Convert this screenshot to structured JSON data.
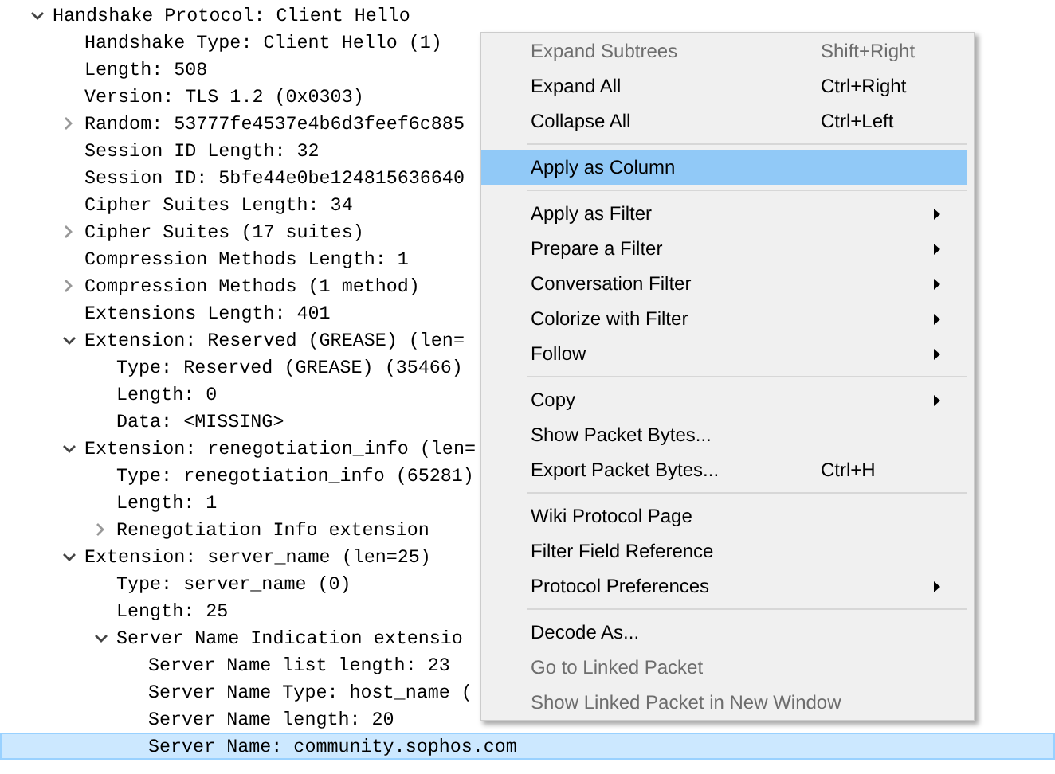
{
  "tree": [
    {
      "label": "Handshake Protocol: Client Hello",
      "expanded": true,
      "selected": false,
      "children": [
        {
          "label": "Handshake Type: Client Hello (1)",
          "selected": false
        },
        {
          "label": "Length: 508",
          "selected": false
        },
        {
          "label": "Version: TLS 1.2 (0x0303)",
          "selected": false
        },
        {
          "label": "Random: 53777fe4537e4b6d3feef6c885",
          "expanded": false,
          "selected": false
        },
        {
          "label": "Session ID Length: 32",
          "selected": false
        },
        {
          "label": "Session ID: 5bfe44e0be124815636640",
          "selected": false
        },
        {
          "label": "Cipher Suites Length: 34",
          "selected": false
        },
        {
          "label": "Cipher Suites (17 suites)",
          "expanded": false,
          "selected": false
        },
        {
          "label": "Compression Methods Length: 1",
          "selected": false
        },
        {
          "label": "Compression Methods (1 method)",
          "expanded": false,
          "selected": false
        },
        {
          "label": "Extensions Length: 401",
          "selected": false
        },
        {
          "label": "Extension: Reserved (GREASE) (len=",
          "expanded": true,
          "selected": false,
          "children": [
            {
              "label": "Type: Reserved (GREASE) (35466)",
              "selected": false
            },
            {
              "label": "Length: 0",
              "selected": false
            },
            {
              "label": "Data: <MISSING>",
              "selected": false
            }
          ]
        },
        {
          "label": "Extension: renegotiation_info (len=",
          "expanded": true,
          "selected": false,
          "children": [
            {
              "label": "Type: renegotiation_info (65281)",
              "selected": false
            },
            {
              "label": "Length: 1",
              "selected": false
            },
            {
              "label": "Renegotiation Info extension",
              "expanded": false,
              "selected": false
            }
          ]
        },
        {
          "label": "Extension: server_name (len=25)",
          "expanded": true,
          "selected": false,
          "children": [
            {
              "label": "Type: server_name (0)",
              "selected": false
            },
            {
              "label": "Length: 25",
              "selected": false
            },
            {
              "label": "Server Name Indication extensio",
              "expanded": true,
              "selected": false,
              "children": [
                {
                  "label": "Server Name list length: 23",
                  "selected": false
                },
                {
                  "label": "Server Name Type: host_name (",
                  "selected": false
                },
                {
                  "label": "Server Name length: 20",
                  "selected": false
                },
                {
                  "label": "Server Name: community.sophos.com",
                  "selected": true
                }
              ]
            }
          ]
        }
      ]
    }
  ],
  "context_menu": [
    {
      "kind": "item",
      "label": "Expand Subtrees",
      "shortcut": "Shift+Right",
      "disabled": true,
      "selected": false,
      "submenu": false
    },
    {
      "kind": "item",
      "label": "Expand All",
      "shortcut": "Ctrl+Right",
      "disabled": false,
      "selected": false,
      "submenu": false
    },
    {
      "kind": "item",
      "label": "Collapse All",
      "shortcut": "Ctrl+Left",
      "disabled": false,
      "selected": false,
      "submenu": false
    },
    {
      "kind": "separator"
    },
    {
      "kind": "item",
      "label": "Apply as Column",
      "disabled": false,
      "selected": true,
      "submenu": false
    },
    {
      "kind": "separator"
    },
    {
      "kind": "item",
      "label": "Apply as Filter",
      "disabled": false,
      "selected": false,
      "submenu": true
    },
    {
      "kind": "item",
      "label": "Prepare a Filter",
      "disabled": false,
      "selected": false,
      "submenu": true
    },
    {
      "kind": "item",
      "label": "Conversation Filter",
      "disabled": false,
      "selected": false,
      "submenu": true
    },
    {
      "kind": "item",
      "label": "Colorize with Filter",
      "disabled": false,
      "selected": false,
      "submenu": true
    },
    {
      "kind": "item",
      "label": "Follow",
      "disabled": false,
      "selected": false,
      "submenu": true
    },
    {
      "kind": "separator"
    },
    {
      "kind": "item",
      "label": "Copy",
      "disabled": false,
      "selected": false,
      "submenu": true
    },
    {
      "kind": "item",
      "label": "Show Packet Bytes...",
      "disabled": false,
      "selected": false,
      "submenu": false
    },
    {
      "kind": "item",
      "label": "Export Packet Bytes...",
      "shortcut": "Ctrl+H",
      "disabled": false,
      "selected": false,
      "submenu": false
    },
    {
      "kind": "separator"
    },
    {
      "kind": "item",
      "label": "Wiki Protocol Page",
      "disabled": false,
      "selected": false,
      "submenu": false
    },
    {
      "kind": "item",
      "label": "Filter Field Reference",
      "disabled": false,
      "selected": false,
      "submenu": false
    },
    {
      "kind": "item",
      "label": "Protocol Preferences",
      "disabled": false,
      "selected": false,
      "submenu": true
    },
    {
      "kind": "separator"
    },
    {
      "kind": "item",
      "label": "Decode As...",
      "disabled": false,
      "selected": false,
      "submenu": false
    },
    {
      "kind": "item",
      "label": "Go to Linked Packet",
      "disabled": true,
      "selected": false,
      "submenu": false
    },
    {
      "kind": "item",
      "label": "Show Linked Packet in New Window",
      "disabled": true,
      "selected": false,
      "submenu": false
    }
  ]
}
